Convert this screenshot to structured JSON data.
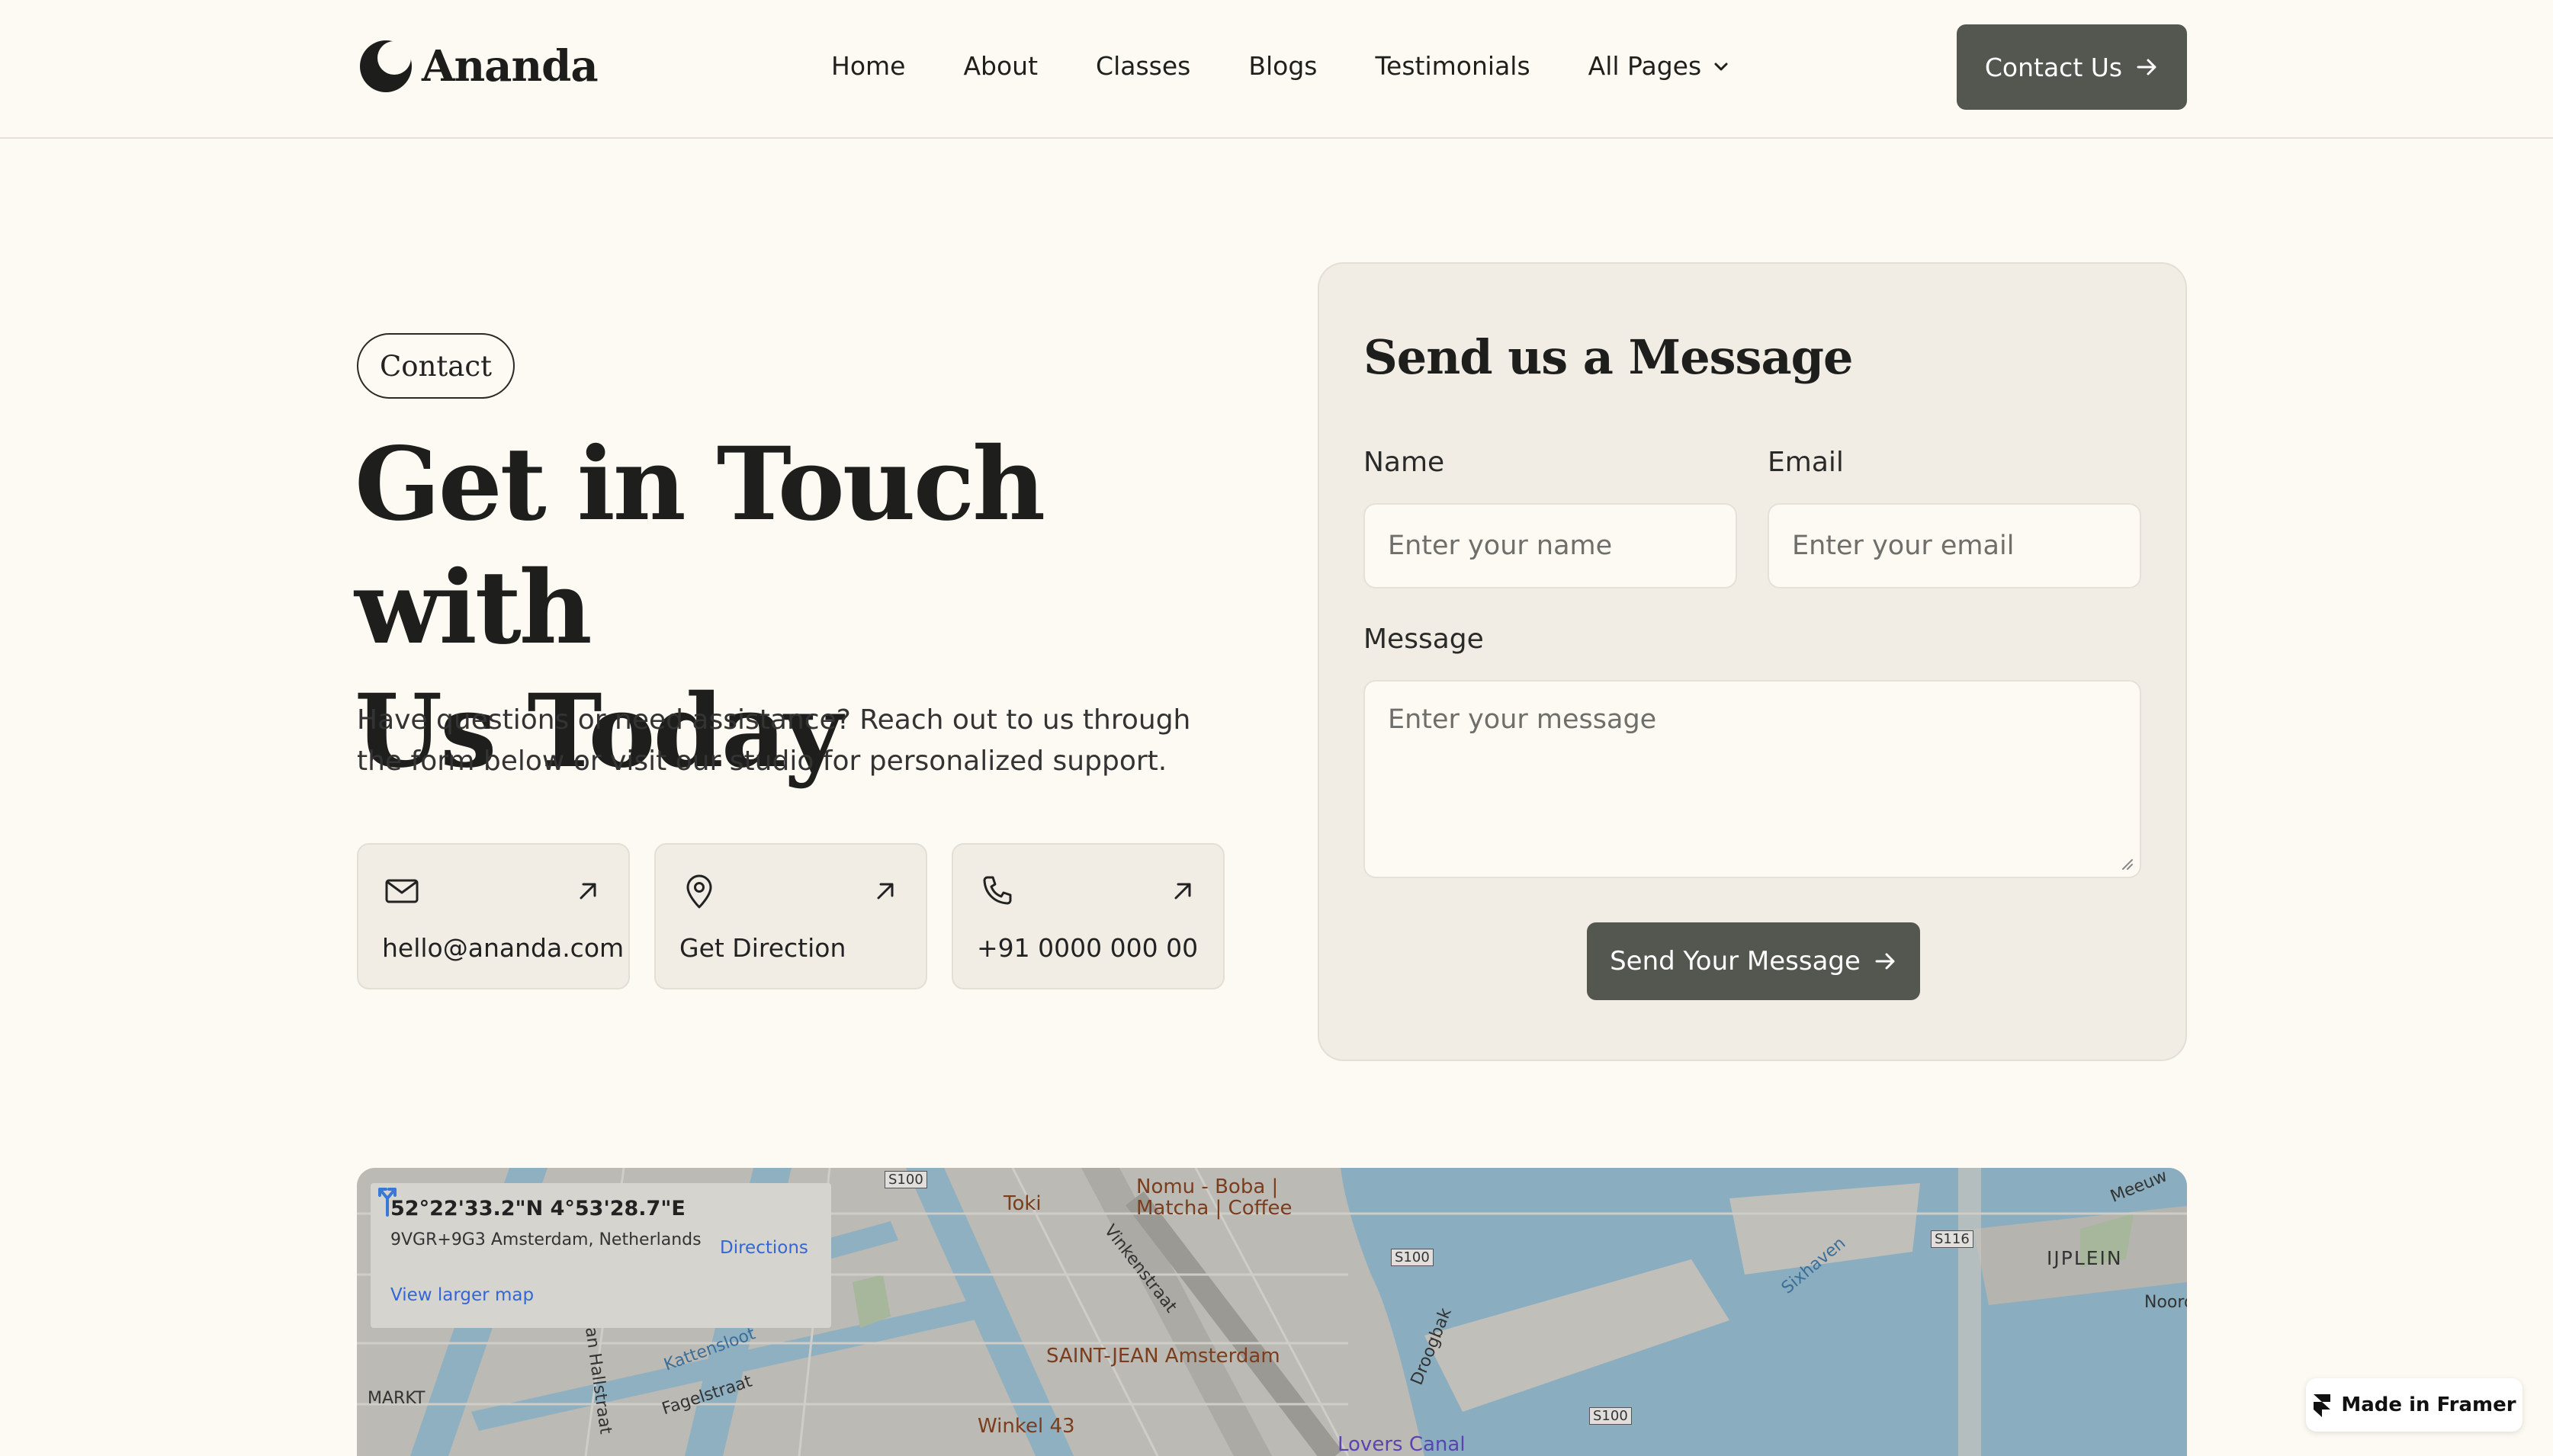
{
  "brand": {
    "name": "Ananda"
  },
  "nav": {
    "items": [
      "Home",
      "About",
      "Classes",
      "Blogs",
      "Testimonials"
    ],
    "dropdown_label": "All Pages",
    "cta_label": "Contact Us"
  },
  "hero": {
    "tag": "Contact",
    "title_line1": "Get in Touch with",
    "title_line2": "Us Today",
    "subtitle": "Have questions or need assistance? Reach out to us through the form below or visit our studio for personalized support."
  },
  "cards": [
    {
      "icon": "mail-icon",
      "label": "hello@ananda.com"
    },
    {
      "icon": "map-pin-icon",
      "label": "Get Direction"
    },
    {
      "icon": "phone-icon",
      "label": "+91 0000 000 00"
    }
  ],
  "form": {
    "title": "Send us a Message",
    "name_label": "Name",
    "name_placeholder": "Enter your name",
    "email_label": "Email",
    "email_placeholder": "Enter your email",
    "message_label": "Message",
    "message_placeholder": "Enter your message",
    "submit_label": "Send Your Message"
  },
  "map": {
    "coords": "52°22'33.2\"N 4°53'28.7\"E",
    "address": "9VGR+9G3 Amsterdam, Netherlands",
    "directions": "Directions",
    "larger": "View larger map",
    "places": [
      "Toki",
      "Nomu - Boba |",
      "Matcha | Coffee",
      "SAINT-JEAN Amsterdam",
      "Winkel 43",
      "Lovers Canal",
      "IJPLEIN"
    ],
    "streets": [
      "Vinkenstraat",
      "Van Hallstraat",
      "Fagelstraat",
      "Droogbak",
      "Sixhaven",
      "Kattensloot",
      "MARKT",
      "Meeuw",
      "Noord"
    ],
    "road_codes": [
      "S100",
      "S100",
      "S100",
      "S116"
    ]
  },
  "badge": {
    "label": "Made in Framer"
  },
  "colors": {
    "background": "#fdf9f3",
    "panel": "#f1ede5",
    "button": "#535750",
    "text": "#1e1e1c"
  }
}
